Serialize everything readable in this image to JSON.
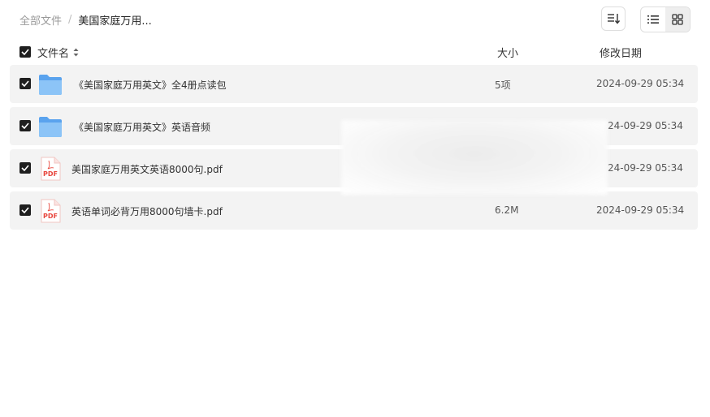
{
  "breadcrumb": {
    "root": "全部文件",
    "separator": "/",
    "current": "美国家庭万用..."
  },
  "toolbar": {
    "sort_icon": "sort-lines-icon",
    "list_view_icon": "list-view-icon",
    "grid_view_icon": "grid-view-icon"
  },
  "table": {
    "headers": {
      "name": "文件名",
      "size": "大小",
      "date": "修改日期"
    },
    "rows": [
      {
        "type": "folder",
        "name": "《美国家庭万用英文》全4册点读包",
        "size": "5项",
        "date": "2024-09-29 05:34",
        "checked": true
      },
      {
        "type": "folder",
        "name": "《美国家庭万用英文》英语音频",
        "size": "",
        "date": "24-09-29 05:34",
        "checked": true
      },
      {
        "type": "pdf",
        "name": "美国家庭万用英文英语8000句.pdf",
        "size": "",
        "date": "24-09-29 05:34",
        "checked": true
      },
      {
        "type": "pdf",
        "name": "英语单词必背万用8000句墙卡.pdf",
        "size": "6.2M",
        "date": "2024-09-29 05:34",
        "checked": true
      }
    ]
  },
  "colors": {
    "folder": "#6fb1f1",
    "pdf_red": "#e8453c",
    "row_bg": "#f3f3f3",
    "checkbox": "#1f1f1f"
  }
}
